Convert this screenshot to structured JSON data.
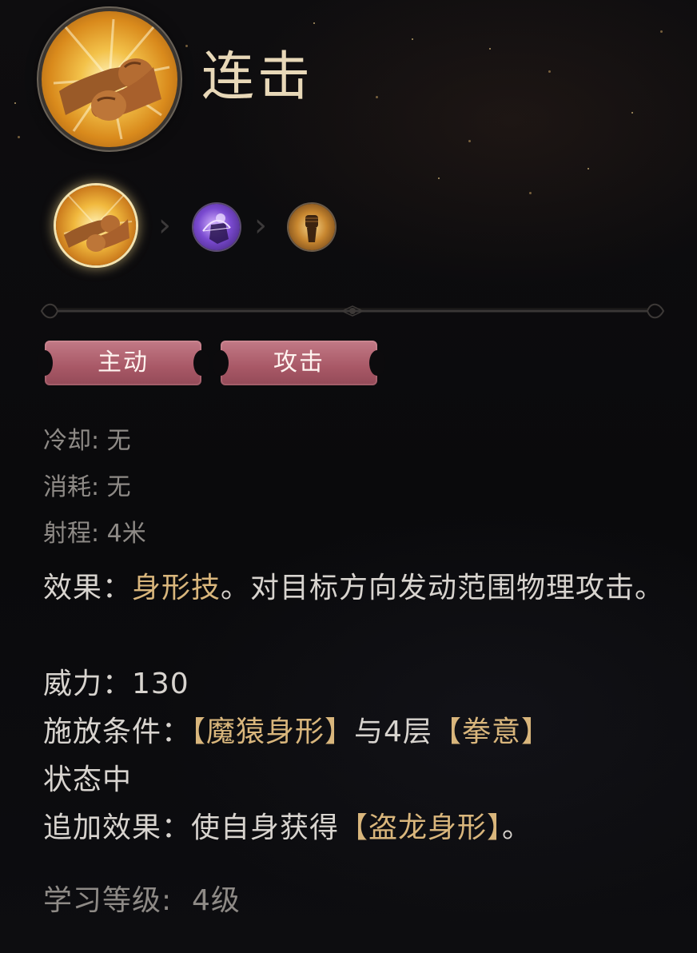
{
  "skill": {
    "name": "连击",
    "main_icon": "fist-bump-icon"
  },
  "chain": {
    "items": [
      {
        "icon": "fist-bump-icon",
        "selected": true
      },
      {
        "icon": "ape-archer-icon",
        "selected": false
      },
      {
        "icon": "raised-fist-icon",
        "selected": false
      }
    ],
    "separator_icon": "chevron-right-icon"
  },
  "tags": [
    "主动",
    "攻击"
  ],
  "stats": {
    "cooldown": "冷却: 无",
    "cost": "消耗: 无",
    "range": "射程: 4米"
  },
  "effect": {
    "label": "效果：",
    "highlight": "身形技",
    "text": "。对目标方向发动范围物理攻击。"
  },
  "power": "威力：130",
  "condition": {
    "label": "施放条件：",
    "form": "【魔猿身形】",
    "joiner": "与4层",
    "stack": "【拳意】",
    "tail": "状态中"
  },
  "extra_effect": {
    "label": "追加效果：使自身获得",
    "form": "【盗龙身形】",
    "tail": "。"
  },
  "learn_level": "学习等级:  4级",
  "colors": {
    "highlight": "#d9b67c",
    "tag_bg": "#a85866",
    "title": "#e8d8b8",
    "muted": "#8e8a86",
    "text": "#d8d4cf"
  }
}
